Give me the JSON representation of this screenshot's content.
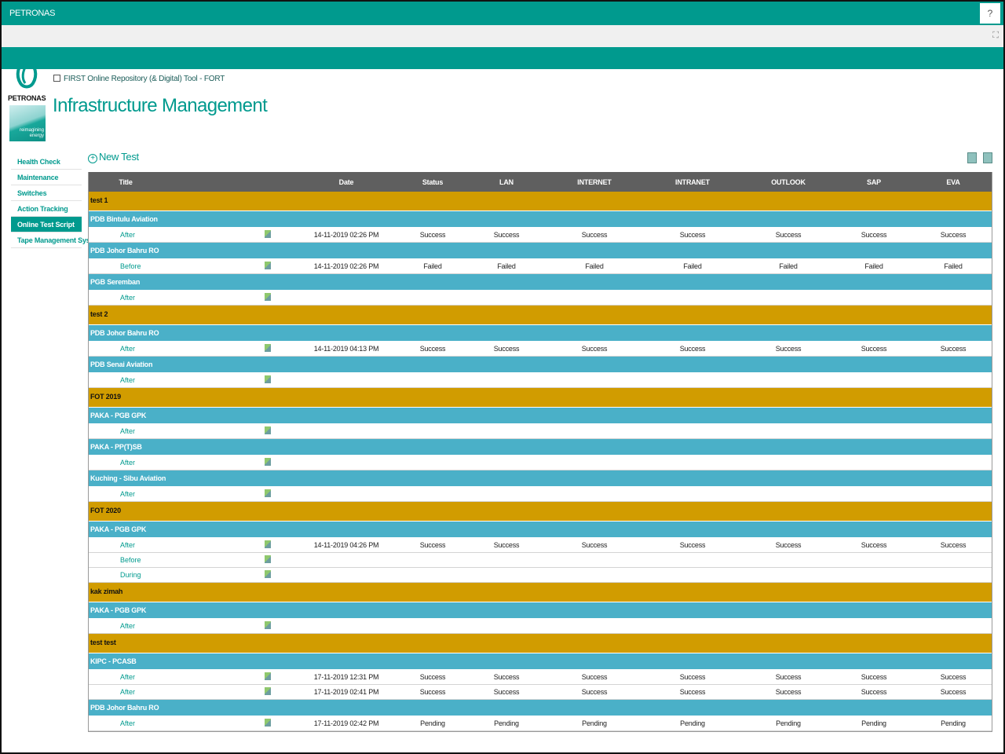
{
  "suitebar": {
    "brand": "PETRONAS",
    "help_label": "?",
    "focus_icon": "focus-icon"
  },
  "logo": {
    "word": "PETRONAS",
    "tagline": "reimagining energy"
  },
  "breadcrumb": "FIRST Online Repository (& Digital) Tool - FORT",
  "page_title": "Infrastructure Management",
  "nav": [
    {
      "label": "Health Check",
      "selected": false
    },
    {
      "label": "Maintenance",
      "selected": false
    },
    {
      "label": "Switches",
      "selected": false
    },
    {
      "label": "Action Tracking",
      "selected": false
    },
    {
      "label": "Online Test Script",
      "selected": true
    },
    {
      "label": "Tape Management System",
      "selected": false
    }
  ],
  "toolbar": {
    "new_label": "New Test"
  },
  "columns": [
    "Title",
    "Date",
    "Status",
    "LAN",
    "INTERNET",
    "INTRANET",
    "OUTLOOK",
    "SAP",
    "EVA"
  ],
  "colors": {
    "brand": "#009a8e",
    "group1": "#d19c00",
    "group2": "#4ab0c8",
    "header": "#5f5f5f"
  },
  "groups": [
    {
      "name": "test 1",
      "sites": [
        {
          "name": "PDB Bintulu Aviation",
          "items": [
            {
              "title": "After",
              "date": "14-11-2019 02:26 PM",
              "status": "Success",
              "lan": "Success",
              "internet": "Success",
              "intranet": "Success",
              "outlook": "Success",
              "sap": "Success",
              "eva": "Success"
            }
          ]
        },
        {
          "name": "PDB Johor Bahru RO",
          "items": [
            {
              "title": "Before",
              "date": "14-11-2019 02:26 PM",
              "status": "Failed",
              "lan": "Failed",
              "internet": "Failed",
              "intranet": "Failed",
              "outlook": "Failed",
              "sap": "Failed",
              "eva": "Failed"
            }
          ]
        },
        {
          "name": "PGB Seremban",
          "items": [
            {
              "title": "After"
            }
          ]
        }
      ]
    },
    {
      "name": "test 2",
      "sites": [
        {
          "name": "PDB Johor Bahru RO",
          "items": [
            {
              "title": "After",
              "date": "14-11-2019 04:13 PM",
              "status": "Success",
              "lan": "Success",
              "internet": "Success",
              "intranet": "Success",
              "outlook": "Success",
              "sap": "Success",
              "eva": "Success"
            }
          ]
        },
        {
          "name": "PDB Senai Aviation",
          "items": [
            {
              "title": "After"
            }
          ]
        }
      ]
    },
    {
      "name": "FOT 2019",
      "sites": [
        {
          "name": "PAKA - PGB GPK",
          "items": [
            {
              "title": "After"
            }
          ]
        },
        {
          "name": "PAKA - PP(T)SB",
          "items": [
            {
              "title": "After"
            }
          ]
        },
        {
          "name": "Kuching - Sibu Aviation",
          "items": [
            {
              "title": "After"
            }
          ]
        }
      ]
    },
    {
      "name": "FOT 2020",
      "sites": [
        {
          "name": "PAKA - PGB GPK",
          "items": [
            {
              "title": "After",
              "date": "14-11-2019 04:26 PM",
              "status": "Success",
              "lan": "Success",
              "internet": "Success",
              "intranet": "Success",
              "outlook": "Success",
              "sap": "Success",
              "eva": "Success"
            },
            {
              "title": "Before"
            },
            {
              "title": "During"
            }
          ]
        }
      ]
    },
    {
      "name": "kak zimah",
      "sites": [
        {
          "name": "PAKA - PGB GPK",
          "items": [
            {
              "title": "After"
            }
          ]
        }
      ]
    },
    {
      "name": "test test",
      "sites": [
        {
          "name": "KIPC - PCASB",
          "items": [
            {
              "title": "After",
              "date": "17-11-2019 12:31 PM",
              "status": "Success",
              "lan": "Success",
              "internet": "Success",
              "intranet": "Success",
              "outlook": "Success",
              "sap": "Success",
              "eva": "Success"
            },
            {
              "title": "After",
              "date": "17-11-2019 02:41 PM",
              "status": "Success",
              "lan": "Success",
              "internet": "Success",
              "intranet": "Success",
              "outlook": "Success",
              "sap": "Success",
              "eva": "Success"
            }
          ]
        },
        {
          "name": "PDB Johor Bahru RO",
          "items": [
            {
              "title": "After",
              "date": "17-11-2019 02:42 PM",
              "status": "Pending",
              "lan": "Pending",
              "internet": "Pending",
              "intranet": "Pending",
              "outlook": "Pending",
              "sap": "Pending",
              "eva": "Pending"
            }
          ]
        }
      ]
    }
  ]
}
